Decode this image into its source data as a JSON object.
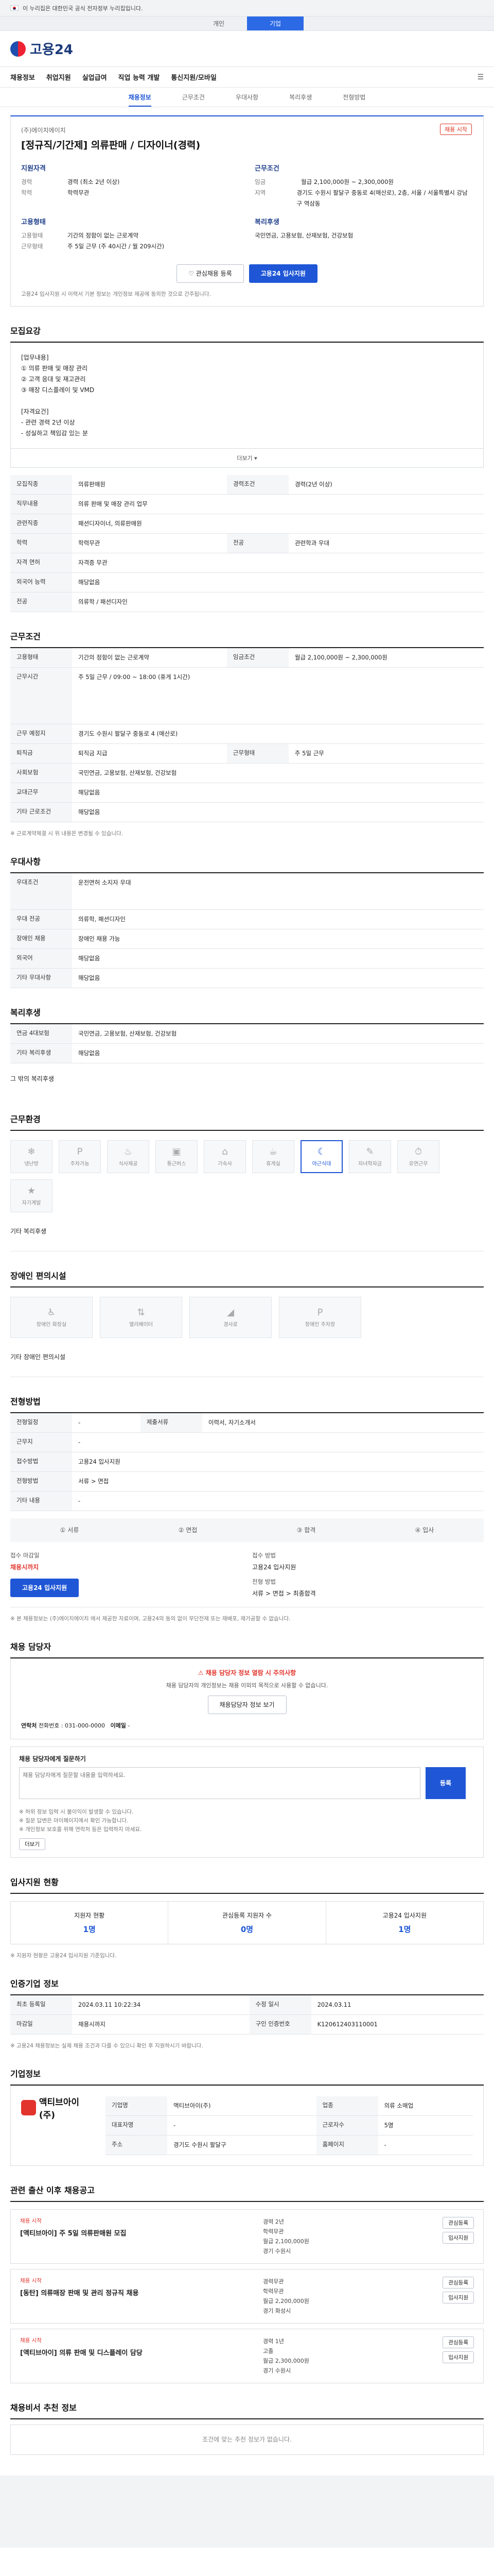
{
  "gov_banner": "이 누리집은 대한민국 공식 전자정부 누리집입니다.",
  "user_tabs": [
    "개인",
    "기업"
  ],
  "logo_text": "고용24",
  "nav": [
    "채용정보",
    "취업지원",
    "실업급여",
    "직업 능력 개발",
    "통신지원/모바일"
  ],
  "subnav": [
    "채용정보",
    "근무조건",
    "우대사항",
    "복리후생",
    "전형방법"
  ],
  "company": "(주)에이치에이치",
  "job_title": "[정규직/기간제] 의류판매 / 디자이너(경력)",
  "status_badge": "채용 시작",
  "summary": {
    "left_title": "지원자격",
    "left": [
      [
        "경력",
        "경력 (최소 2년 이상)"
      ],
      [
        "학력",
        "학력무관"
      ],
      [
        "",
        ""
      ]
    ],
    "right_title": "근무조건",
    "right": [
      [
        "임금",
        "월급 2,100,000원 ~ 2,300,000원"
      ],
      [
        "지역",
        "경기도 수원시 팔달구 중동로 4(매산로), 2층, 서울 / 서울특별시 강남구 역삼동"
      ],
      [
        "",
        ""
      ]
    ],
    "left2_title": "고용형태",
    "left2": [
      [
        "고용형태",
        "기간의 정함이 없는 근로계약"
      ],
      [
        "근무형태",
        "주 5일 근무 (주 40시간 / 월 209시간)"
      ]
    ],
    "right2_title": "복리후생",
    "right2": [
      [
        "",
        "국민연금, 고용보험, 산재보험, 건강보험"
      ]
    ]
  },
  "btns": {
    "interest": "관심채용 등록",
    "apply": "고용24 입사지원"
  },
  "summary_note": "고용24 입사지원 시 이력서 기본 정보는 개인정보 제공에 동의한 것으로 간주됩니다.",
  "sections": {
    "recruit": "모집요강",
    "cond": "근무조건",
    "pref": "우대사항",
    "welfare": "복리후생",
    "work_env": "근무환경",
    "env": "장애인 편의시설",
    "apply": "전형방법",
    "manager": "채용 담당자",
    "stat": "입사지원 현황",
    "period": "인증기업 정보",
    "corp": "기업정보",
    "related": "관련 출산 이후 채용공고",
    "similar": "채용비서 추천 정보"
  },
  "job_desc": "[업무내용]\n① 의류 판매 및 매장 관리\n② 고객 응대 및 재고관리\n③ 매장 디스플레이 및 VMD\n\n[자격요건]\n- 관련 경력 2년 이상\n- 성실하고 책임감 있는 분",
  "more": "더보기 ▾",
  "recruit_rows": [
    [
      "모집직종",
      "의류판매원",
      "경력조건",
      "경력(2년 이상)"
    ],
    [
      "직무내용",
      "의류 판매 및 매장 관리 업무",
      "",
      ""
    ],
    [
      "관련직종",
      "패션디자이너, 의류판매원",
      "",
      ""
    ],
    [
      "학력",
      "학력무관",
      "전공",
      "관련학과 우대"
    ],
    [
      "자격 면허",
      "자격증 무관",
      "",
      ""
    ],
    [
      "외국어 능력",
      "해당없음",
      "",
      ""
    ],
    [
      "전공",
      "의류학 / 패션디자인",
      "",
      ""
    ]
  ],
  "cond_rows": [
    [
      "고용형태",
      "기간의 정함이 없는 근로계약",
      "임금조건",
      "월급 2,100,000원 ~ 2,300,000원"
    ],
    [
      "근무시간",
      "주 5일 근무 / 09:00 ~ 18:00 (휴게 1시간)",
      "",
      ""
    ],
    [
      "근무 예정지",
      "경기도 수원시 팔달구 중동로 4 (매산로)",
      "",
      ""
    ],
    [
      "퇴직금",
      "퇴직금 지급",
      "근무형태",
      "주 5일 근무"
    ],
    [
      "사회보험",
      "국민연금, 고용보험, 산재보험, 건강보험",
      "",
      ""
    ],
    [
      "교대근무",
      "해당없음",
      "",
      ""
    ],
    [
      "기타 근로조건",
      "해당없음",
      "",
      ""
    ]
  ],
  "cond_note": "※ 근로계약체결 시 위 내용은 변경될 수 있습니다.",
  "pref_rows": [
    [
      "우대조건",
      "운전면허 소지자 우대"
    ],
    [
      "우대 전공",
      "의류학, 패션디자인"
    ],
    [
      "장애인 채용",
      "장애인 채용 가능"
    ],
    [
      "외국어",
      "해당없음"
    ],
    [
      "기타 우대사항",
      "해당없음"
    ]
  ],
  "welfare_rows": [
    [
      "연금 4대보험",
      "국민연금, 고용보험, 산재보험, 건강보험"
    ],
    [
      "기타 복리후생",
      "해당없음"
    ]
  ],
  "welfare_extra": "그 밖의 복리후생",
  "work_env_items": [
    "냉난방",
    "주차가능",
    "식사제공",
    "통근버스",
    "기숙사",
    "휴게실",
    "야근식대",
    "자녀학자금",
    "유연근무",
    "자기계발"
  ],
  "work_env_extra": "기타 복리후생",
  "env_items": [
    "장애인 화장실",
    "엘리베이터",
    "경사로",
    "장애인 주차장"
  ],
  "env_extra": "기타 장애인 편의시설",
  "proc_rows": [
    [
      "전형일정",
      "-",
      "제출서류",
      "이력서, 자기소개서"
    ],
    [
      "근무지",
      "-",
      "",
      ""
    ],
    [
      "접수방법",
      "고용24 입사지원",
      "",
      ""
    ],
    [
      "전형방법",
      "서류 > 면접",
      "",
      ""
    ],
    [
      "기타 내용",
      "-",
      "",
      ""
    ]
  ],
  "steps": [
    "① 서류",
    "② 면접",
    "③ 합격",
    "④ 입사"
  ],
  "apply_box": {
    "deadline_label": "접수 마감일",
    "deadline": "채용시까지",
    "days_label": "접수 방법",
    "days": "고용24 입사지원",
    "btn": "고용24 입사지원",
    "link_label": "전형 방법",
    "link": "서류 > 면접 > 최종합격"
  },
  "apply_notes": "※ 본 채용정보는 (주)에이치에이치 에서 제공한 자료이며, 고용24의 동의 없이 무단전재 또는 재배포, 재가공할 수 없습니다.",
  "mgr": {
    "warn": "채용 담당자 정보 열람 시 주의사항",
    "desc": "채용 담당자의 개인정보는 채용 이외의 목적으로 사용할 수 없습니다.",
    "btn": "채용담당자 정보 보기",
    "contact_label": "연락처",
    "contact": "전화번호 : 031-000-0000",
    "email_label": "이메일",
    "email": "-"
  },
  "qa": {
    "title": "채용 담당자에게 질문하기",
    "placeholder": "채용 담당자에게 질문할 내용을 입력하세요.",
    "btn": "등록"
  },
  "qa_notes": [
    "※ 허위 정보 입력 시 불이익이 발생할 수 있습니다.",
    "※ 질문 답변은 마이페이지에서 확인 가능합니다.",
    "※ 개인정보 보호를 위해 연락처 등은 입력하지 마세요."
  ],
  "qa_more": "더보기",
  "stat_items": [
    [
      "지원자 현황",
      "1명"
    ],
    [
      "관심등록 지원자 수",
      "0명"
    ],
    [
      "고용24 입사지원",
      "1명"
    ]
  ],
  "stat_note": "※ 지원자 현황은 고용24 입사지원 기준입니다.",
  "period_rows": [
    [
      "최초 등록일",
      "2024.03.11 10:22:34",
      "수정 일시",
      "2024.03.11"
    ],
    [
      "마감일",
      "채용시까지",
      "구인 인증번호",
      "K120612403110001"
    ]
  ],
  "period_note": "※ 고용24 채용정보는 실제 채용 조건과 다를 수 있으니 확인 후 지원하시기 바랍니다.",
  "corp": {
    "name": "액티브아이(주)",
    "rows": [
      [
        "기업명",
        "액티브아이(주)",
        "업종",
        "의류 소매업"
      ],
      [
        "대표자명",
        "-",
        "근로자수",
        "5명"
      ],
      [
        "주소",
        "경기도 수원시 팔달구",
        "홈페이지",
        "-"
      ]
    ]
  },
  "related_jobs": [
    {
      "tag": "채용 시작",
      "title": "[액티브아이] 주 5일 의류판매원 모집",
      "c1": "경력 2년",
      "c2": "학력무관",
      "c3": "월급 2,100,000원",
      "loc": "경기 수원시"
    },
    {
      "tag": "채용 시작",
      "title": "[동탄] 의류매장 판매 및 관리 정규직 채용",
      "c1": "경력무관",
      "c2": "학력무관",
      "c3": "월급 2,200,000원",
      "loc": "경기 화성시"
    },
    {
      "tag": "채용 시작",
      "title": "[액티브아이] 의류 판매 및 디스플레이 담당",
      "c1": "경력 1년",
      "c2": "고졸",
      "c3": "월급 2,300,000원",
      "loc": "경기 수원시"
    }
  ],
  "related_btns": [
    "관심등록",
    "입사지원"
  ],
  "similar_empty": "조건에 맞는 추천 정보가 없습니다."
}
